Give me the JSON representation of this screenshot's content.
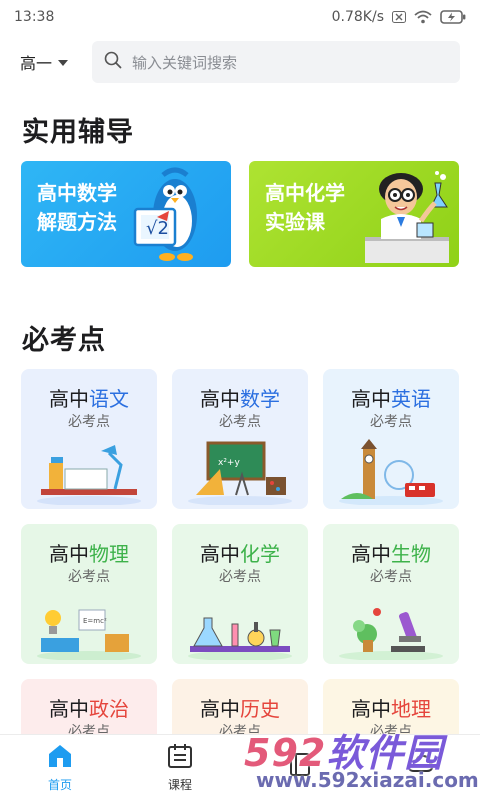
{
  "status_bar": {
    "time": "13:38",
    "network_speed": "0.78K/s",
    "icons": [
      "sim-off-icon",
      "wifi-icon",
      "battery-charging-icon"
    ]
  },
  "header": {
    "grade": "高一",
    "search_placeholder": "输入关键词搜索"
  },
  "tutoring": {
    "title": "实用辅导",
    "banners": [
      {
        "line1": "高中数学",
        "line2": "解题方法"
      },
      {
        "line1": "高中化学",
        "line2": "实验课"
      }
    ]
  },
  "key_points": {
    "title": "必考点",
    "cards": [
      {
        "prefix": "高中",
        "subject": "语文",
        "sub": "必考点",
        "accent": "#2b6fe0",
        "bg": "#e9f0fd"
      },
      {
        "prefix": "高中",
        "subject": "数学",
        "sub": "必考点",
        "accent": "#2b6fe0",
        "bg": "#eaf1fd"
      },
      {
        "prefix": "高中",
        "subject": "英语",
        "sub": "必考点",
        "accent": "#2b6fe0",
        "bg": "#e8f3fd"
      },
      {
        "prefix": "高中",
        "subject": "物理",
        "sub": "必考点",
        "accent": "#3db24a",
        "bg": "#e6f7e7"
      },
      {
        "prefix": "高中",
        "subject": "化学",
        "sub": "必考点",
        "accent": "#3db24a",
        "bg": "#e8f8e9"
      },
      {
        "prefix": "高中",
        "subject": "生物",
        "sub": "必考点",
        "accent": "#3db24a",
        "bg": "#e9f8ea"
      },
      {
        "prefix": "高中",
        "subject": "政治",
        "sub": "必考点",
        "accent": "#e5453c",
        "bg": "#fdecec"
      },
      {
        "prefix": "高中",
        "subject": "历史",
        "sub": "必考点",
        "accent": "#e5453c",
        "bg": "#fdf2e6"
      },
      {
        "prefix": "高中",
        "subject": "地理",
        "sub": "必考点",
        "accent": "#e5453c",
        "bg": "#fdf6e4"
      }
    ]
  },
  "bottom_nav": {
    "items": [
      {
        "label": "首页",
        "icon": "home-icon",
        "active": true
      },
      {
        "label": "课程",
        "icon": "calendar-icon",
        "active": false
      },
      {
        "label": "",
        "icon": "book-icon",
        "active": false
      },
      {
        "label": "",
        "icon": "cloud-icon",
        "active": false
      }
    ]
  },
  "watermark": {
    "logo_number": "592",
    "logo_text": "软件园",
    "url": "www.592xiazai.com"
  },
  "colors": {
    "brand_blue": "#1e9cf0",
    "search_bg": "#f2f3f5",
    "chem_green": "#8fd117"
  }
}
